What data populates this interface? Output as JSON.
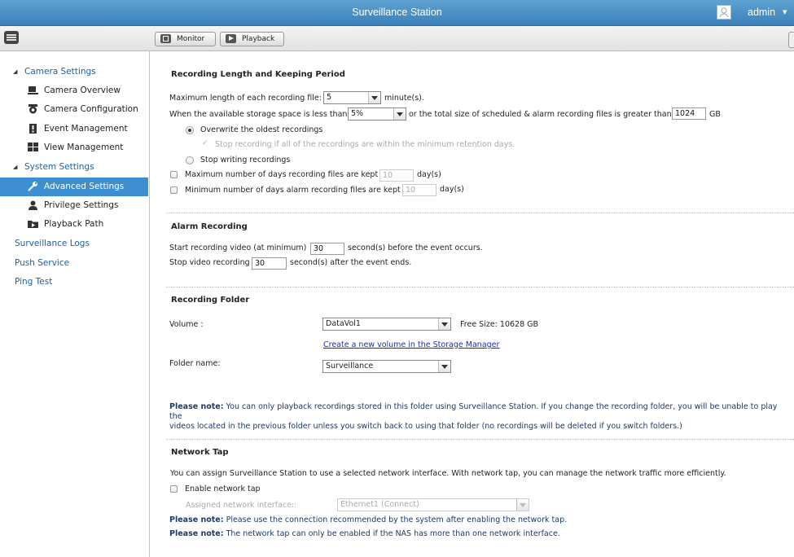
{
  "app": {
    "title": "Surveillance Station",
    "user": "admin"
  },
  "toolbar": {
    "monitor_label": "Monitor",
    "playback_label": "Playback"
  },
  "sidebar": {
    "camera_settings": "Camera Settings",
    "camera_overview": "Camera Overview",
    "camera_configuration": "Camera Configuration",
    "event_management": "Event Management",
    "view_management": "View Management",
    "system_settings": "System Settings",
    "advanced_settings": "Advanced Settings",
    "privilege_settings": "Privilege Settings",
    "playback_path": "Playback Path",
    "surveillance_logs": "Surveillance Logs",
    "push_service": "Push Service",
    "ping_test": "Ping Test"
  },
  "recording_length": {
    "title": "Recording Length and Keeping Period",
    "max_length_label": "Maximum length of each recording file:",
    "max_length_value": "5",
    "max_length_unit": "minute(s).",
    "storage_label_pre": "When the available storage space is less than",
    "storage_percent": "5%",
    "storage_label_mid": "or the total size of scheduled & alarm recording files is greater than",
    "storage_size": "1024",
    "storage_unit": "GB",
    "overwrite_label": "Overwrite the oldest recordings",
    "stop_if_retention_label": "Stop recording if all of the recordings are within the minimum retention days.",
    "stop_writing_label": "Stop writing recordings",
    "max_days_label": "Maximum number of days recording files are kept",
    "max_days_value": "10",
    "min_days_label": "Minimum number of days alarm recording files are kept",
    "min_days_value": "10",
    "days_unit": "day(s)"
  },
  "alarm_recording": {
    "title": "Alarm Recording",
    "start_pre": "Start recording video (at minimum)",
    "start_value": "30",
    "start_post": "second(s) before the event occurs.",
    "stop_pre": "Stop video recording",
    "stop_value": "30",
    "stop_post": "second(s) after the event ends."
  },
  "recording_folder": {
    "title": "Recording Folder",
    "volume_label": "Volume :",
    "volume_value": "DataVol1",
    "free_size": "Free Size: 10628 GB",
    "create_link": "Create a new volume in the Storage Manager",
    "folder_label": "Folder name:",
    "folder_value": "Surveillance",
    "note_prefix": "Please note:",
    "note_line1": "You can only playback recordings stored in this folder using Surveillance Station. If you change the recording folder, you will be unable to play the",
    "note_line2": "videos located in the previous folder unless you switch back to using that folder (no recordings will be deleted if you switch folders.)"
  },
  "network_tap": {
    "title": "Network Tap",
    "description": "You can assign Surveillance Station to use a selected network interface. With network tap, you can manage the network traffic more efficiently.",
    "enable_label": "Enable network tap",
    "interface_label": "Assigned network interface::",
    "interface_value": "Ethernet1 (Connect)",
    "note_prefix": "Please note:",
    "note1": "Please use the connection recommended by the system after enabling the network tap.",
    "note2": "The network tap can only be enabled if the NAS has more than one network interface."
  },
  "colors": {
    "title_bar": "#4a90c8",
    "active_item": "#3d8fd1",
    "nav_link": "#2060a0",
    "note_text": "#1a3a6a"
  }
}
